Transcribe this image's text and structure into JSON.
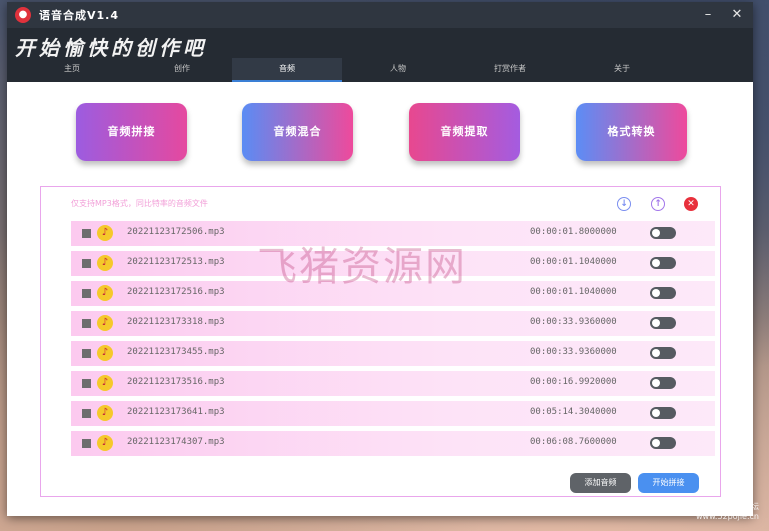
{
  "window": {
    "title": "语音合成V1.4",
    "minimize_glyph": "–",
    "close_glyph": "✕"
  },
  "header": {
    "slogan": "开始愉快的创作吧"
  },
  "tabs": [
    {
      "label": "主页",
      "active": false
    },
    {
      "label": "创作",
      "active": false
    },
    {
      "label": "音频",
      "active": true
    },
    {
      "label": "人物",
      "active": false
    },
    {
      "label": "打赏作者",
      "active": false
    },
    {
      "label": "关于",
      "active": false
    }
  ],
  "actions": [
    {
      "label": "音频拼接"
    },
    {
      "label": "音频混合"
    },
    {
      "label": "音频提取"
    },
    {
      "label": "格式转换"
    }
  ],
  "panel": {
    "hint": "仅支持MP3格式，同比特率的音频文件",
    "files": [
      {
        "name": "20221123172506.mp3",
        "duration": "00:00:01.8000000"
      },
      {
        "name": "20221123172513.mp3",
        "duration": "00:00:01.1040000"
      },
      {
        "name": "20221123172516.mp3",
        "duration": "00:00:01.1040000"
      },
      {
        "name": "20221123173318.mp3",
        "duration": "00:00:33.9360000"
      },
      {
        "name": "20221123173455.mp3",
        "duration": "00:00:33.9360000"
      },
      {
        "name": "20221123173516.mp3",
        "duration": "00:00:16.9920000"
      },
      {
        "name": "20221123173641.mp3",
        "duration": "00:05:14.3040000"
      },
      {
        "name": "20221123174307.mp3",
        "duration": "00:06:08.7600000"
      }
    ],
    "add_button": "添加音频",
    "start_button": "开始拼接"
  },
  "watermark": "飞猪资源网",
  "site_mark": "吾爱破解论坛\nwww.52pojie.cn",
  "colors": {
    "titlebar": "#2f3640",
    "header": "#252b33",
    "accent_blue": "#4a90f0",
    "row_pink": "#fccaef",
    "close_red": "#e8303c"
  }
}
